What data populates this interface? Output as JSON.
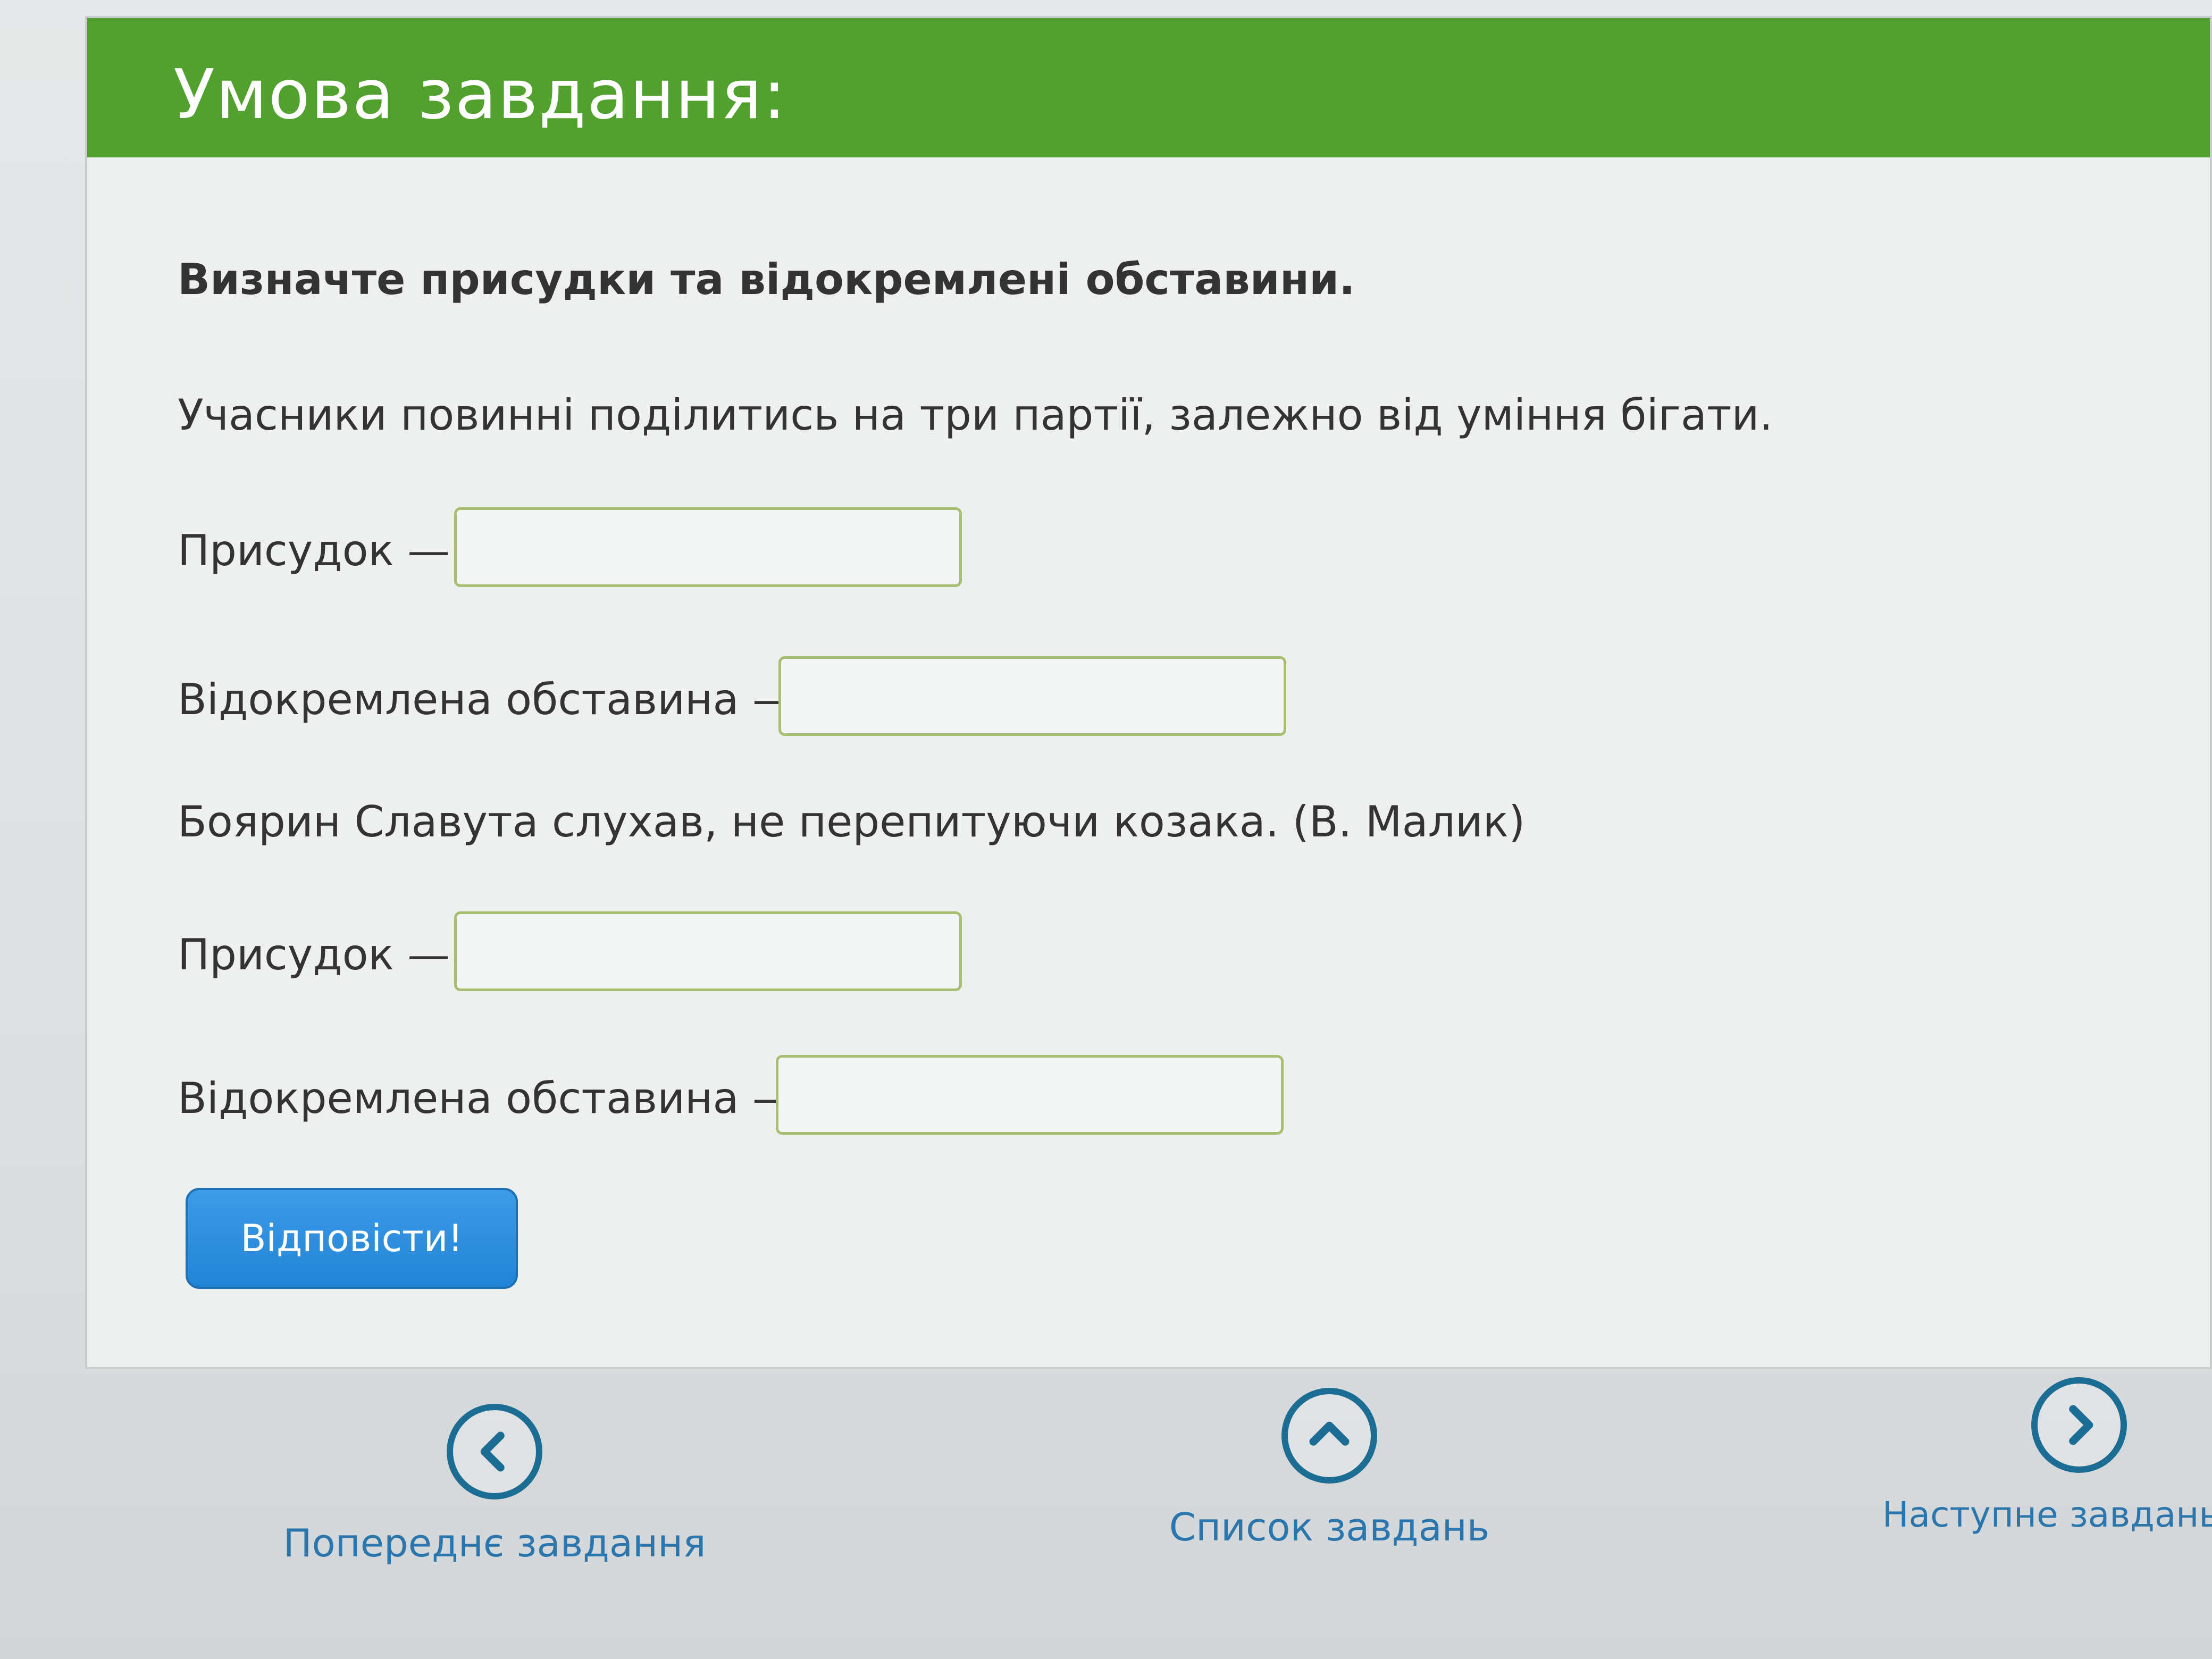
{
  "header": {
    "title": "Умова завдання:"
  },
  "task": {
    "instruction": "Визначте  присудки та відокремлені обставини.",
    "sentences": [
      {
        "text": "Учасники повинні поділитись на три партії, залежно від уміння бігати.",
        "predicate_label": "Присудок —",
        "predicate_value": "",
        "adverbial_label": "Відокремлена обставина —",
        "adverbial_value": ""
      },
      {
        "text": "Боярин Славута слухав, не перепитуючи козака. (В. Малик)",
        "predicate_label": "Присудок —",
        "predicate_value": "",
        "adverbial_label": "Відокремлена обставина —",
        "adverbial_value": ""
      }
    ],
    "submit_label": "Відповісти!"
  },
  "navigation": {
    "previous_label": "Попереднє завдання",
    "list_label": "Список завдань",
    "next_label": "Наступне завдань"
  },
  "colors": {
    "header_green": "#52a12f",
    "button_blue": "#2284d6",
    "nav_link_blue": "#2a76ad",
    "input_border_green": "#a7bf6f"
  },
  "icons": {
    "previous": "chevron-left-circle-icon",
    "list": "chevron-up-circle-icon",
    "next": "chevron-right-circle-icon"
  }
}
